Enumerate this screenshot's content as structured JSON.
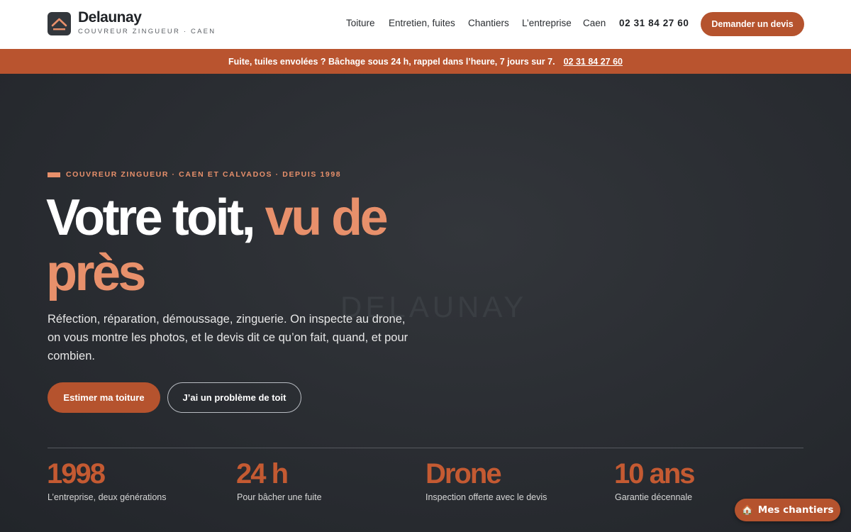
{
  "brand": {
    "name": "Delaunay",
    "tagline": "COUVREUR ZINGUEUR · CAEN"
  },
  "nav": {
    "items": [
      "Toiture",
      "Entretien, fuites",
      "Chantiers",
      "L’entreprise",
      "Caen"
    ],
    "phone": "02 31 84 27 60",
    "cta": "Demander un devis"
  },
  "alert": {
    "text": "Fuite, tuiles envolées ? Bâchage sous 24 h, rappel dans l’heure, 7 jours sur 7.",
    "phone": "02 31 84 27 60"
  },
  "hero": {
    "watermark": "DELAUNAY",
    "eyebrow": "COUVREUR ZINGUEUR · CAEN ET CALVADOS · DEPUIS 1998",
    "headline_main": "Votre toit, ",
    "headline_accent": "vu de près",
    "lead": "Réfection, réparation, démoussage, zinguerie. On inspecte au drone, on vous montre les photos, et le devis dit ce qu’on fait, quand, et pour combien.",
    "primary_cta": "Estimer ma toiture",
    "secondary_cta": "J’ai un problème de toit"
  },
  "stats": [
    {
      "value": "1998",
      "label": "L’entreprise, deux générations"
    },
    {
      "value": "24 h",
      "label": "Pour bâcher une fuite"
    },
    {
      "value": "Drone",
      "label": "Inspection offerte avec le devis"
    },
    {
      "value": "10 ans",
      "label": "Garantie décennale"
    }
  ],
  "floating": {
    "label": "Mes chantiers",
    "icon": "house-icon"
  },
  "colors": {
    "accent": "#b5532e",
    "accent_light": "#e8906b",
    "dark": "#2a2d31"
  }
}
